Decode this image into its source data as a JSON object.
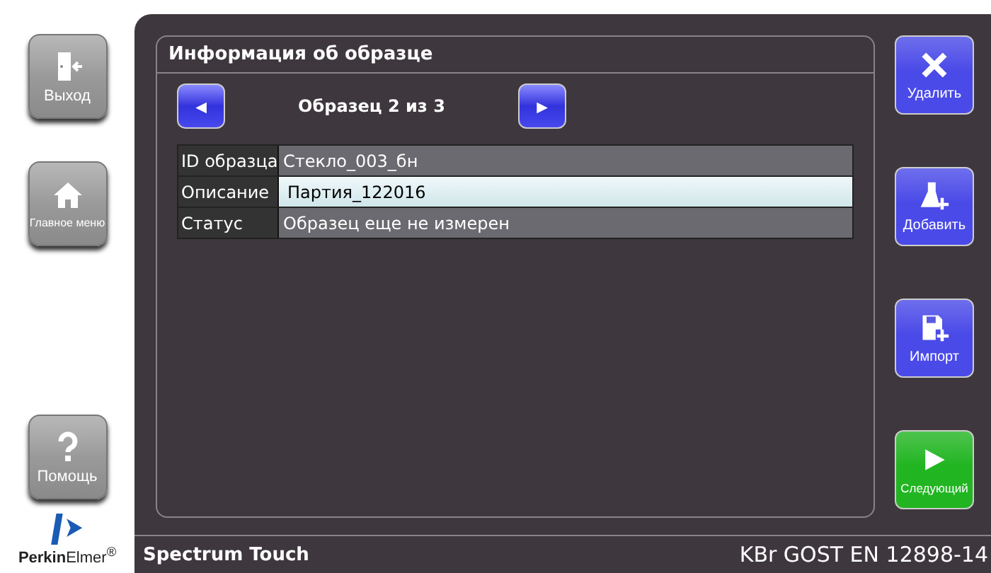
{
  "left_buttons": [
    {
      "kind": "exit",
      "label": "Выход"
    },
    {
      "kind": "home",
      "label": "Главное меню"
    },
    {
      "kind": "help",
      "label": "Помощь"
    }
  ],
  "logo": {
    "text": "**Perkin**Elmer$^{®}$"
  },
  "panel": {
    "title": "Информация об образце",
    "nav": {
      "prev": "◄",
      "label": "Образец  2 из 3",
      "next": "►"
    },
    "rows": [
      {
        "label": "ID образца",
        "value": "Стекло_003_бн",
        "selected": false
      },
      {
        "label": "Описание",
        "value": "Партия_122016",
        "selected": true
      },
      {
        "label": "Статус",
        "value": "Образец еще не измерен",
        "selected": false
      }
    ]
  },
  "right_buttons": [
    {
      "kind": "delete",
      "label": "Удалить",
      "color": "#4a4ae8"
    },
    {
      "kind": "add",
      "label": "Добавить",
      "color": "#4a4ae8"
    },
    {
      "kind": "import",
      "label": "Импорт",
      "color": "#4a4ae8"
    },
    {
      "kind": "next",
      "label": "Следующий",
      "color": "#22b522"
    }
  ],
  "status_bar": {
    "app": "Spectrum Touch",
    "method": "KBr GOST EN 12898-14"
  }
}
